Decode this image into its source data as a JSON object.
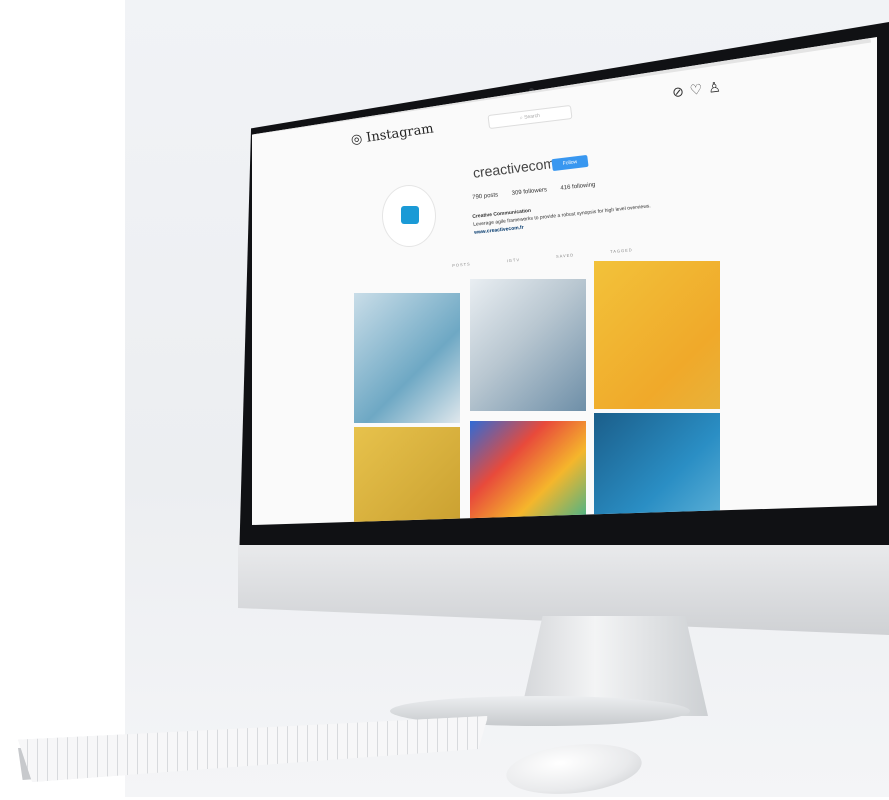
{
  "instagram": {
    "brand": "Instagram",
    "search_placeholder": "Search",
    "nav_icons": [
      "compass-icon",
      "heart-icon",
      "user-icon"
    ],
    "profile": {
      "username": "creactivecom",
      "follow_label": "Follow",
      "posts": "790 posts",
      "followers": "309 followers",
      "following": "416 following",
      "display_name": "Creative Communication",
      "bio": "Leverage agile frameworks to provide a robust synopsis for high level overviews.",
      "website": "www.creactivecom.fr"
    },
    "tabs": [
      "POSTS",
      "IGTV",
      "SAVED",
      "TAGGED"
    ]
  },
  "colors": {
    "follow_blue": "#3897f0",
    "avatar_blue": "#1b9ad6"
  }
}
